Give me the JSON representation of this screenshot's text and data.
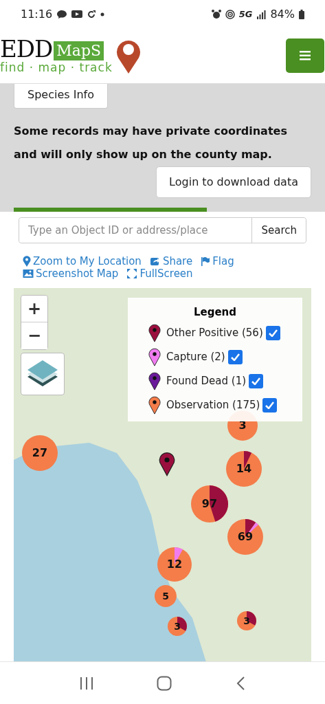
{
  "status_bar": {
    "time": "11:16",
    "network": "5G",
    "battery": "84%"
  },
  "header": {
    "logo_main": "EDD",
    "logo_badge": "MapS",
    "logo_tagline": "find · map · track"
  },
  "tabs": [
    {
      "label": "Species Info",
      "selected": true
    }
  ],
  "notice": "Some records may have private coordinates and will only show up on the county map.",
  "login_button": "Login to download data",
  "progress": {
    "level": 0.65
  },
  "search": {
    "placeholder": "Type an Object ID or address/place",
    "button": "Search"
  },
  "map_links": [
    {
      "kind": "location",
      "label": "Zoom to My Location"
    },
    {
      "kind": "share",
      "label": "Share"
    },
    {
      "kind": "flag",
      "label": "Flag"
    },
    {
      "kind": "screenshot",
      "label": "Screenshot Map"
    },
    {
      "kind": "fullscreen",
      "label": "FullScreen"
    }
  ],
  "map": {
    "zoom_in": "+",
    "zoom_out": "−",
    "legend": {
      "title": "Legend",
      "items": [
        {
          "label": "Other Positive (56)",
          "color": "#9b0f3e",
          "checked": true
        },
        {
          "label": "Capture (2)",
          "color": "#f07cf0",
          "checked": true
        },
        {
          "label": "Found Dead (1)",
          "color": "#6a1b9a",
          "checked": true
        },
        {
          "label": "Observation (175)",
          "color": "#f47d4a",
          "checked": true
        }
      ]
    },
    "clusters": [
      {
        "count": "3"
      },
      {
        "count": "27"
      },
      {
        "count": "14"
      },
      {
        "count": "97"
      },
      {
        "count": "69"
      },
      {
        "count": "12"
      },
      {
        "count": "5"
      },
      {
        "count": "3"
      },
      {
        "count": "3"
      }
    ]
  }
}
